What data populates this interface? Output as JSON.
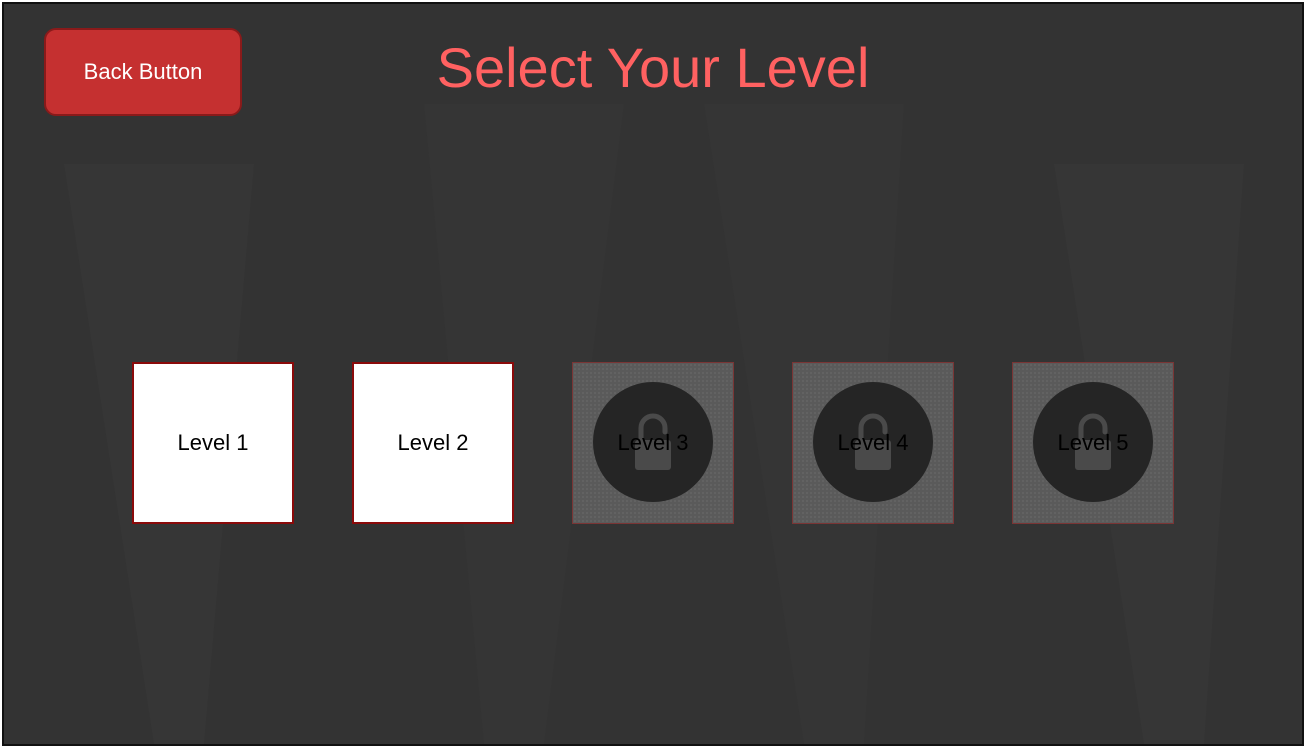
{
  "header": {
    "back_label": "Back Button",
    "title": "Select Your Level"
  },
  "levels": [
    {
      "label": "Level 1",
      "state": "unlocked"
    },
    {
      "label": "Level 2",
      "state": "unlocked"
    },
    {
      "label": "Level 3",
      "state": "locked",
      "icon": "unlock-icon"
    },
    {
      "label": "Level 4",
      "state": "locked",
      "icon": "unlock-icon"
    },
    {
      "label": "Level 5",
      "state": "locked",
      "icon": "unlock-icon"
    }
  ],
  "colors": {
    "background": "#333333",
    "accent": "#ff6161",
    "button": "#c53030",
    "locked_tile": "#5a5a5a"
  }
}
